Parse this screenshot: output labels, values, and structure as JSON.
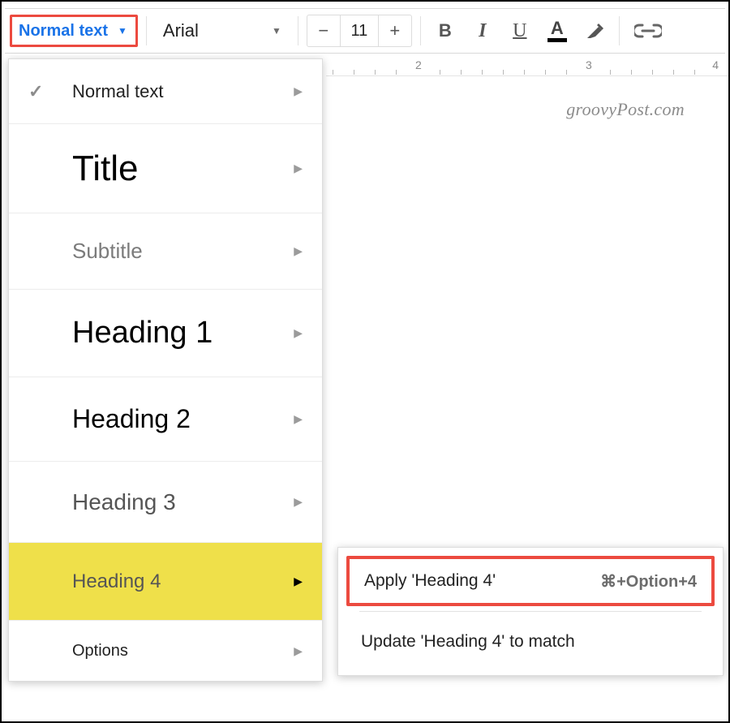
{
  "toolbar": {
    "style_label": "Normal text",
    "font_label": "Arial",
    "font_size": "11"
  },
  "ruler": {
    "n2": "2",
    "n3": "3",
    "n4": "4"
  },
  "watermark": "groovyPost.com",
  "dropdown": {
    "normal": "Normal text",
    "title": "Title",
    "subtitle": "Subtitle",
    "h1": "Heading 1",
    "h2": "Heading 2",
    "h3": "Heading 3",
    "h4": "Heading 4",
    "options": "Options"
  },
  "submenu": {
    "apply_label": "Apply 'Heading 4'",
    "apply_shortcut": "⌘+Option+4",
    "update_label": "Update 'Heading 4' to match"
  }
}
